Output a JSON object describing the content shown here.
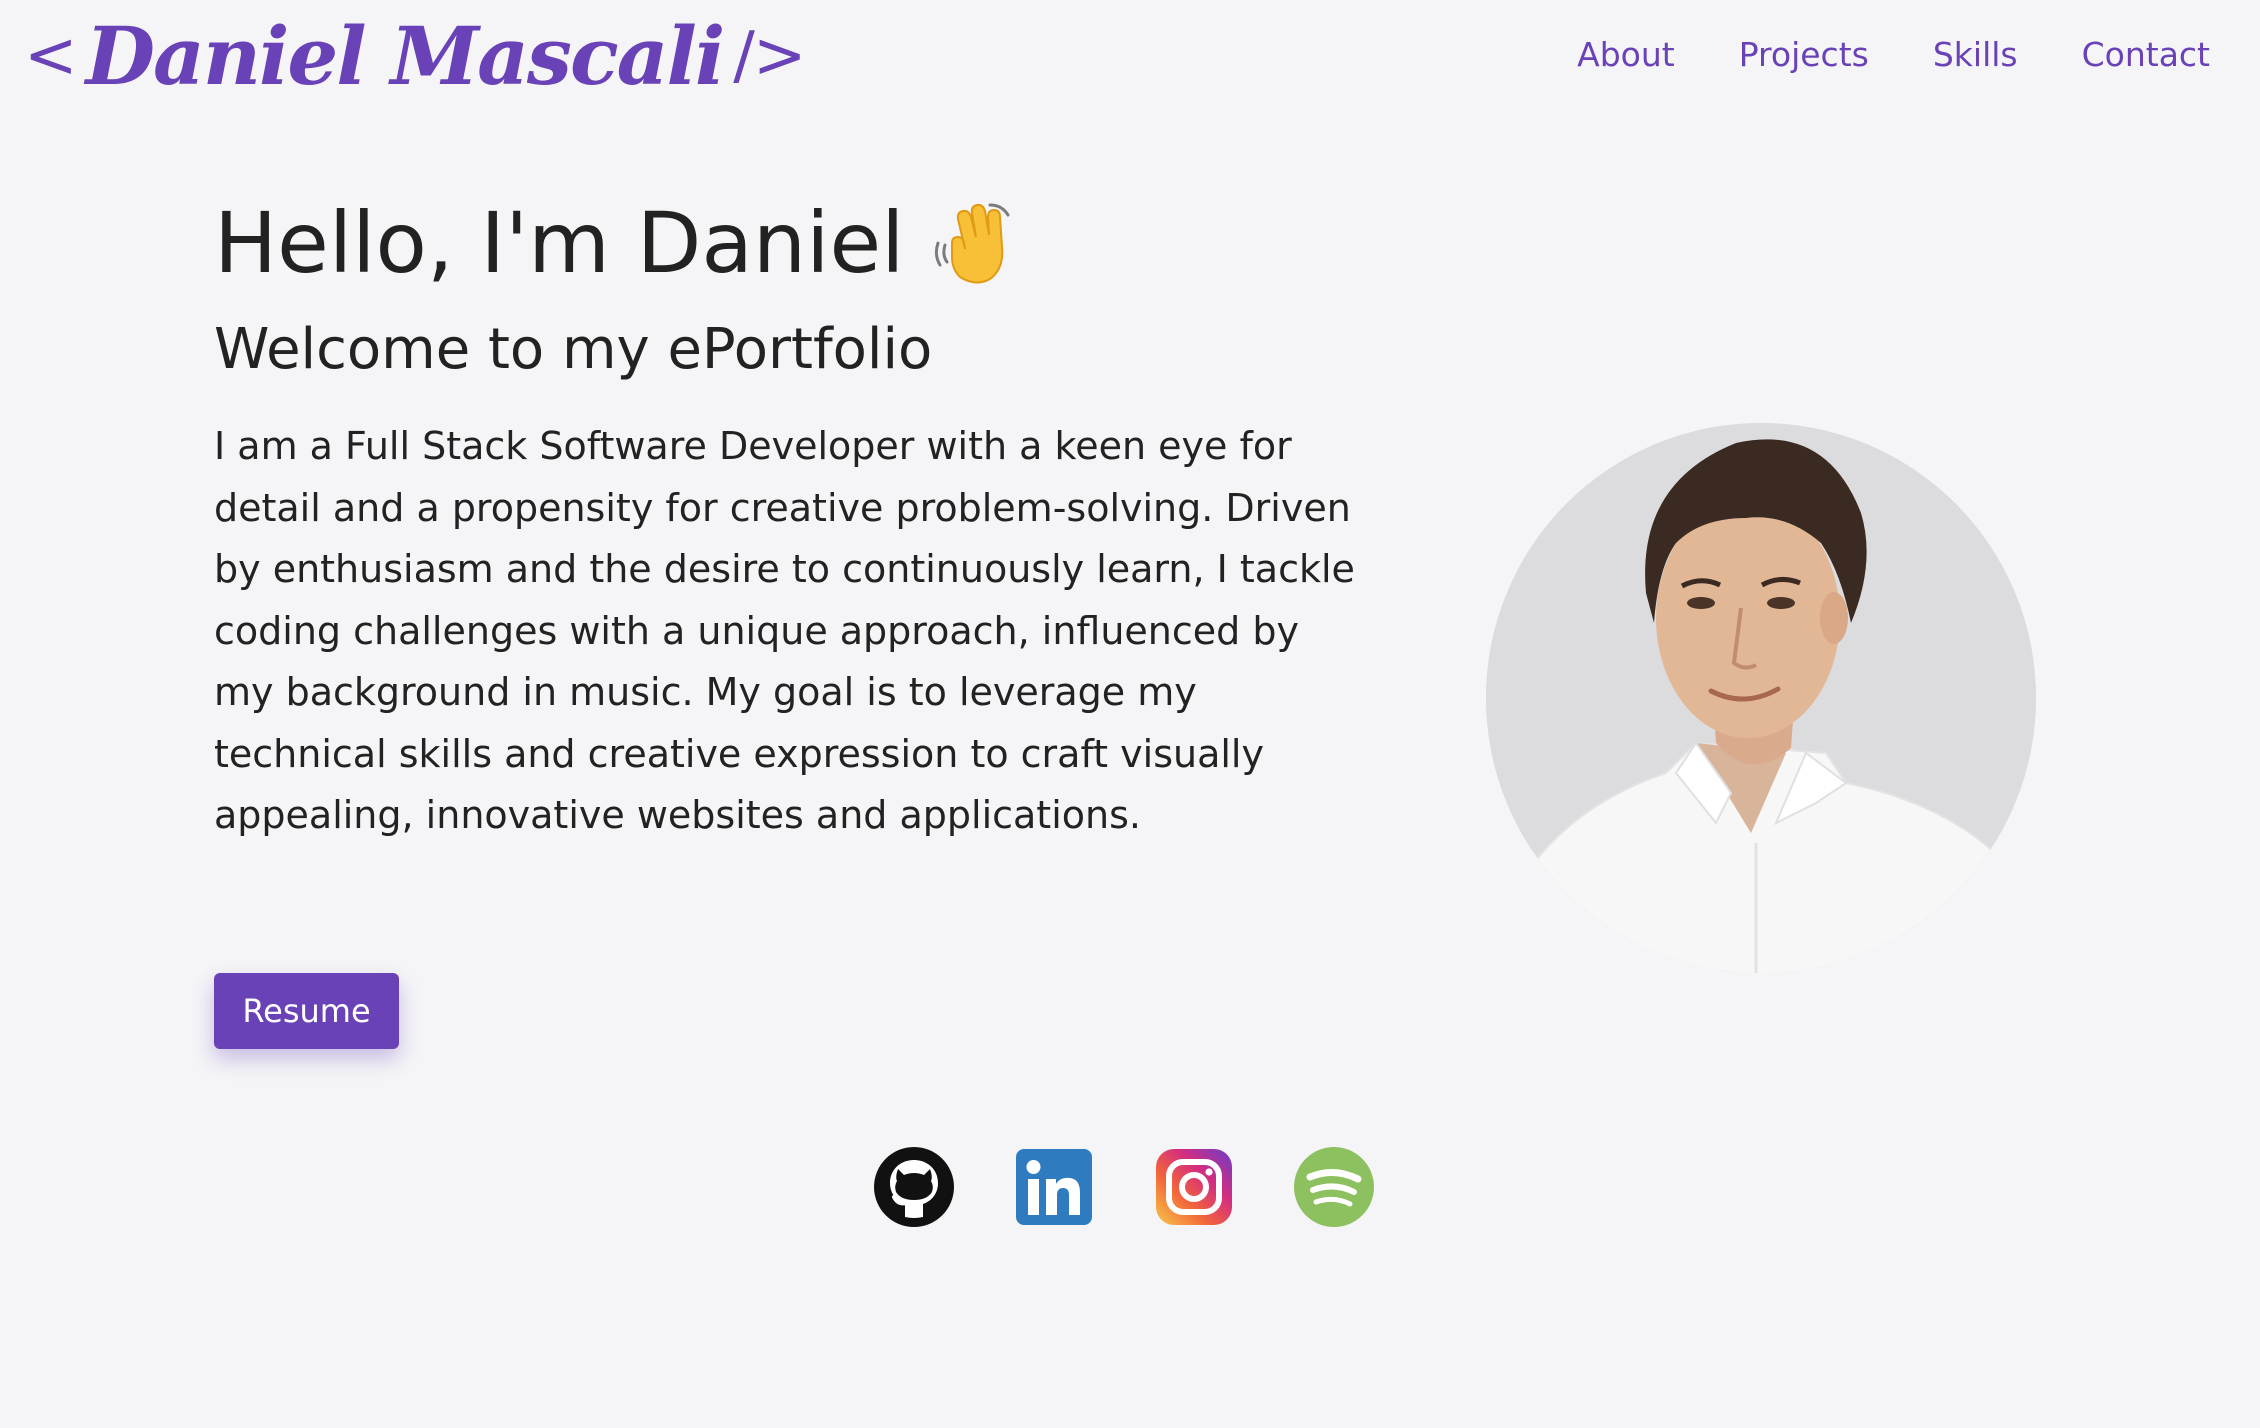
{
  "header": {
    "logo_open": "<",
    "logo_name": "Daniel Mascali",
    "logo_close": "/>",
    "nav": [
      {
        "label": "About"
      },
      {
        "label": "Projects"
      },
      {
        "label": "Skills"
      },
      {
        "label": "Contact"
      }
    ]
  },
  "hero": {
    "greeting": "Hello, I'm Daniel",
    "greeting_icon": "waving-hand-emoji",
    "subtitle": "Welcome to my ePortfolio",
    "bio": "I am a Full Stack Software Developer with a keen eye for detail and a propensity for creative problem-solving. Driven by enthusiasm and the desire to continuously learn, I tackle coding challenges with a unique approach, influenced by my background in music. My goal is to leverage my technical skills and creative expression to craft visually appealing, innovative websites and applications.",
    "resume_label": "Resume"
  },
  "portrait": {
    "icon": "profile-photo"
  },
  "socials": [
    {
      "icon": "github-icon"
    },
    {
      "icon": "linkedin-icon"
    },
    {
      "icon": "instagram-icon"
    },
    {
      "icon": "spotify-icon"
    }
  ],
  "colors": {
    "accent": "#6a42b8",
    "background": "#f5f5f7",
    "text": "#222222",
    "linkedin": "#2f7bbf",
    "spotify": "#8dc05e",
    "github": "#111111"
  }
}
